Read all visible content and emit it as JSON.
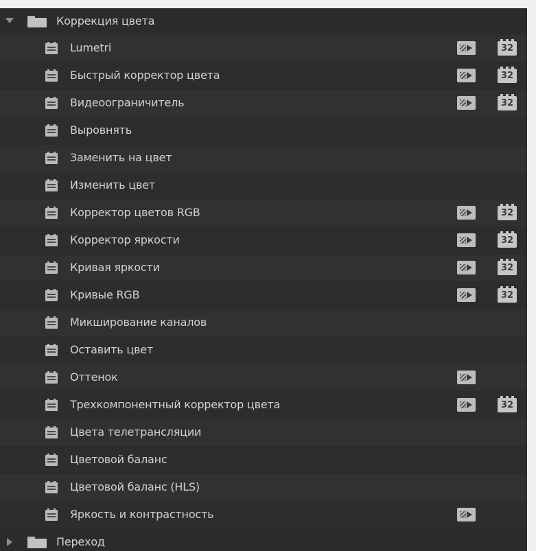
{
  "folder": {
    "label": "Коррекция цвета",
    "expanded": true,
    "icon": "folder-icon"
  },
  "items": [
    {
      "label": "Lumetri",
      "accelerated": true,
      "bit32": true
    },
    {
      "label": "Быстрый корректор цвета",
      "accelerated": true,
      "bit32": true
    },
    {
      "label": "Видеоограничитель",
      "accelerated": true,
      "bit32": true
    },
    {
      "label": "Выровнять",
      "accelerated": false,
      "bit32": false
    },
    {
      "label": "Заменить на цвет",
      "accelerated": false,
      "bit32": false
    },
    {
      "label": "Изменить цвет",
      "accelerated": false,
      "bit32": false
    },
    {
      "label": "Корректор цветов RGB",
      "accelerated": true,
      "bit32": true
    },
    {
      "label": "Корректор яркости",
      "accelerated": true,
      "bit32": true
    },
    {
      "label": "Кривая яркости",
      "accelerated": true,
      "bit32": true
    },
    {
      "label": "Кривые RGB",
      "accelerated": true,
      "bit32": true
    },
    {
      "label": "Микширование каналов",
      "accelerated": false,
      "bit32": false
    },
    {
      "label": "Оставить цвет",
      "accelerated": false,
      "bit32": false
    },
    {
      "label": "Оттенок",
      "accelerated": true,
      "bit32": false
    },
    {
      "label": "Трехкомпонентный корректор цвета",
      "accelerated": true,
      "bit32": true
    },
    {
      "label": "Цвета телетрансляции",
      "accelerated": false,
      "bit32": false
    },
    {
      "label": "Цветовой баланс",
      "accelerated": false,
      "bit32": false
    },
    {
      "label": "Цветовой баланс (HLS)",
      "accelerated": false,
      "bit32": false
    },
    {
      "label": "Яркость и контрастность",
      "accelerated": true,
      "bit32": false
    }
  ],
  "next_folder": {
    "label": "Переход",
    "expanded": false,
    "icon": "folder-icon"
  },
  "badges": {
    "bit32_text": "32",
    "accelerated_icon": "accelerated-effect-icon",
    "effect_icon": "effect-icon"
  }
}
